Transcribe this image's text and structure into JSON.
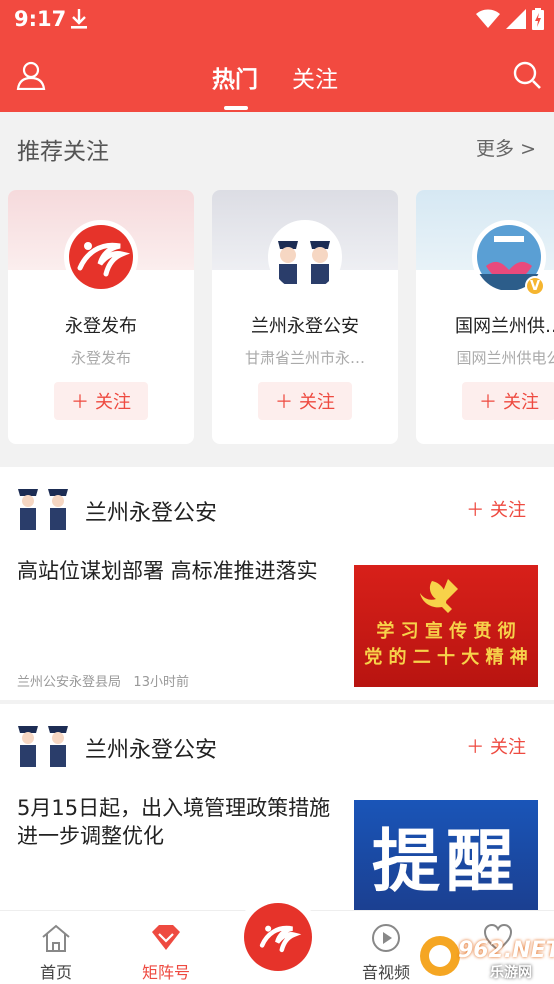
{
  "status_bar": {
    "time": "9:17"
  },
  "header": {
    "tabs": [
      {
        "label": "热门",
        "active": true
      },
      {
        "label": "关注",
        "active": false
      }
    ],
    "accent_color": "#f24a40"
  },
  "recommend": {
    "title": "推荐关注",
    "more_label": "更多 >",
    "cards": [
      {
        "name": "永登发布",
        "desc": "永登发布",
        "follow_label": "关注"
      },
      {
        "name": "兰州永登公安",
        "desc": "甘肃省兰州市永…",
        "follow_label": "关注"
      },
      {
        "name": "国网兰州供…",
        "desc": "国网兰州供电公",
        "follow_label": "关注",
        "verified_badge": "V"
      }
    ]
  },
  "posts": [
    {
      "author": "兰州永登公安",
      "follow_label": "关注",
      "title": "高站位谋划部署 高标准推进落实",
      "source": "兰州公安永登县局",
      "time": "13小时前",
      "thumb_text_1": "学 习 宣 传 贯 彻",
      "thumb_text_2": "党 的 二 十 大 精 神"
    },
    {
      "author": "兰州永登公安",
      "follow_label": "关注",
      "title": "5月15日起，出入境管理政策措施进一步调整优化",
      "thumb_text": "提醒"
    }
  ],
  "bottom_nav": {
    "items": [
      {
        "label": "首页",
        "icon": "home-icon"
      },
      {
        "label": "矩阵号",
        "icon": "diamond-icon",
        "active": true
      },
      {
        "label": "音视频",
        "icon": "play-icon"
      }
    ]
  },
  "watermark": {
    "text": "962.NET",
    "sub": "乐游网"
  }
}
